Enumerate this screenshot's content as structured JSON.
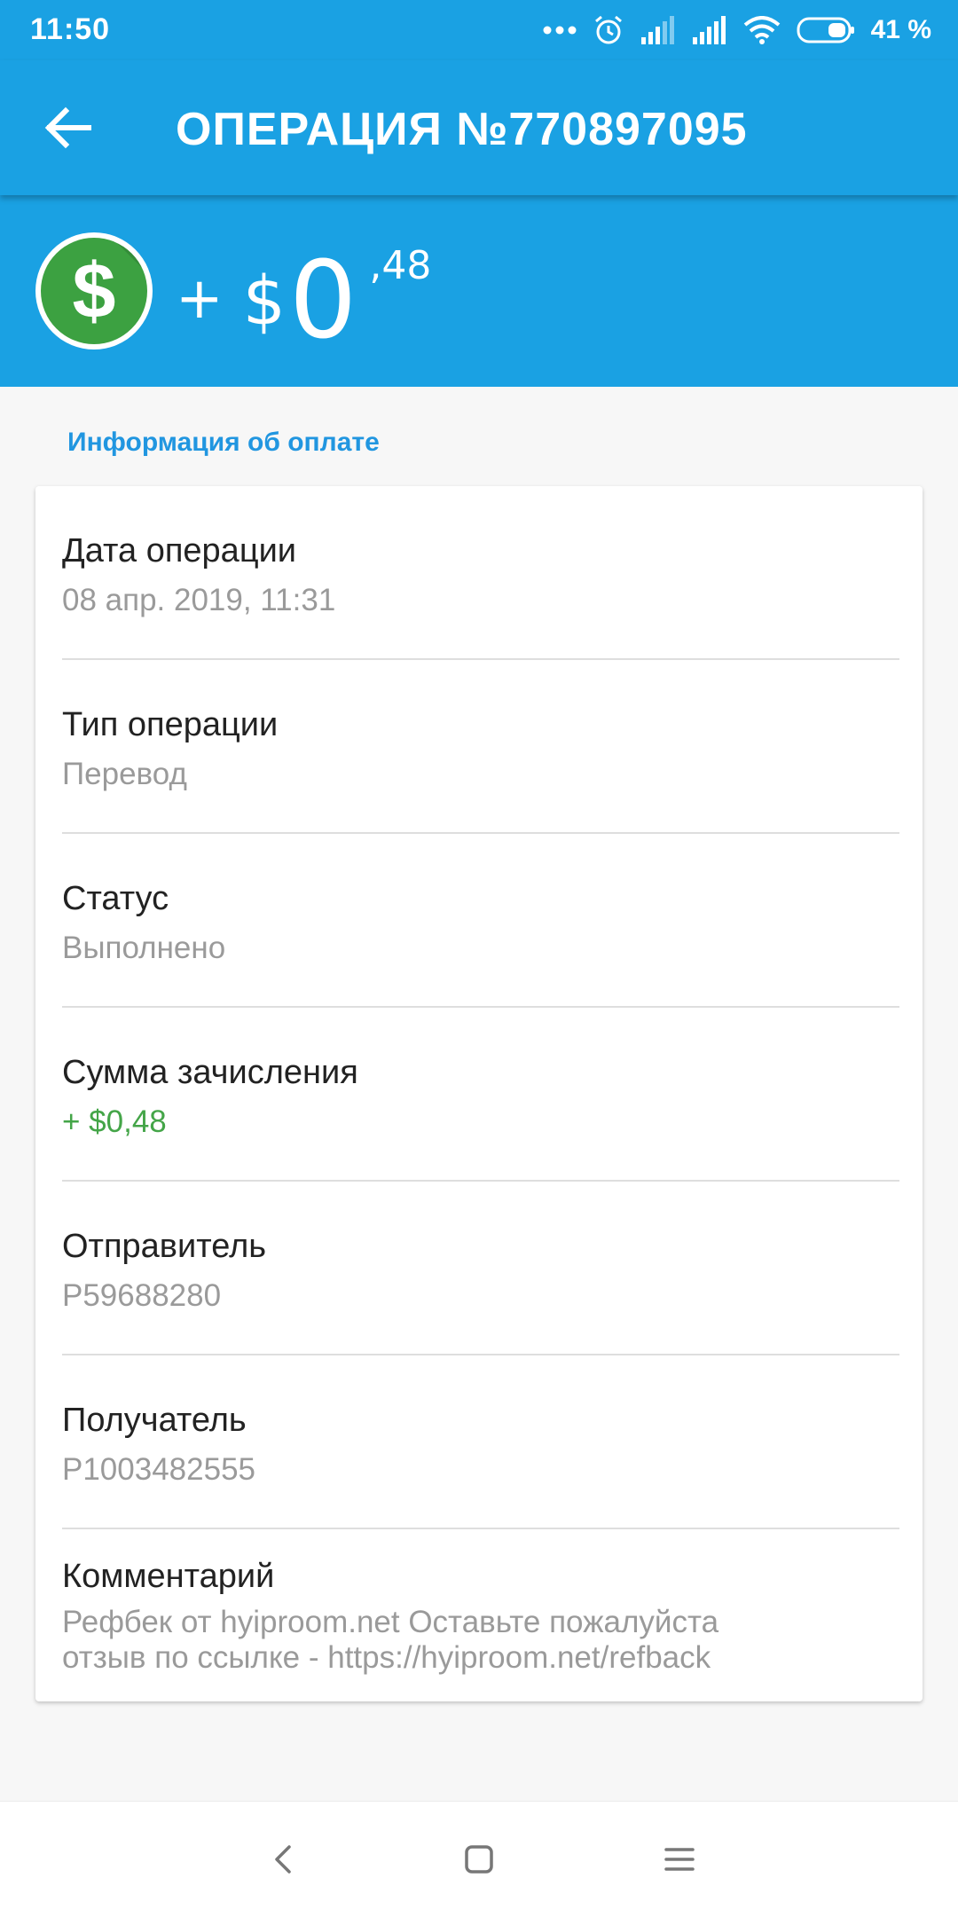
{
  "status_bar": {
    "time": "11:50",
    "battery_text": "41 %",
    "icons": [
      "more-dots-icon",
      "alarm-icon",
      "signal-icon",
      "signal-icon",
      "wifi-icon",
      "battery-icon"
    ]
  },
  "app_bar": {
    "back_icon": "arrow-left-icon",
    "title": "ОПЕРАЦИЯ №770897095"
  },
  "amount_header": {
    "icon": "dollar-icon",
    "icon_glyph": "$",
    "sign": "+",
    "currency": "$",
    "whole": "0",
    "fraction": ",48"
  },
  "section": {
    "title": "Информация об оплате"
  },
  "fields": [
    {
      "label": "Дата операции",
      "value": "08 апр. 2019, 11:31"
    },
    {
      "label": "Тип операции",
      "value": "Перевод"
    },
    {
      "label": "Статус",
      "value": "Выполнено"
    },
    {
      "label": "Сумма зачисления",
      "value": "+ $0,48"
    },
    {
      "label": "Отправитель",
      "value": "P59688280"
    },
    {
      "label": "Получатель",
      "value": "P1003482555"
    },
    {
      "label": "Комментарий",
      "value_line1": "Рефбек от hyiproom.net  Оставьте пожалуйста",
      "value_line2": "отзыв по ссылке - https://hyiproom.net/refback"
    }
  ],
  "nav_bar": {
    "icons": [
      "back-nav-icon",
      "home-nav-icon",
      "menu-nav-icon"
    ]
  },
  "colors": {
    "primary": "#1aa1e3",
    "accent_text": "#2196e0",
    "positive": "#44a548",
    "dollar_bg": "#3ca141"
  }
}
